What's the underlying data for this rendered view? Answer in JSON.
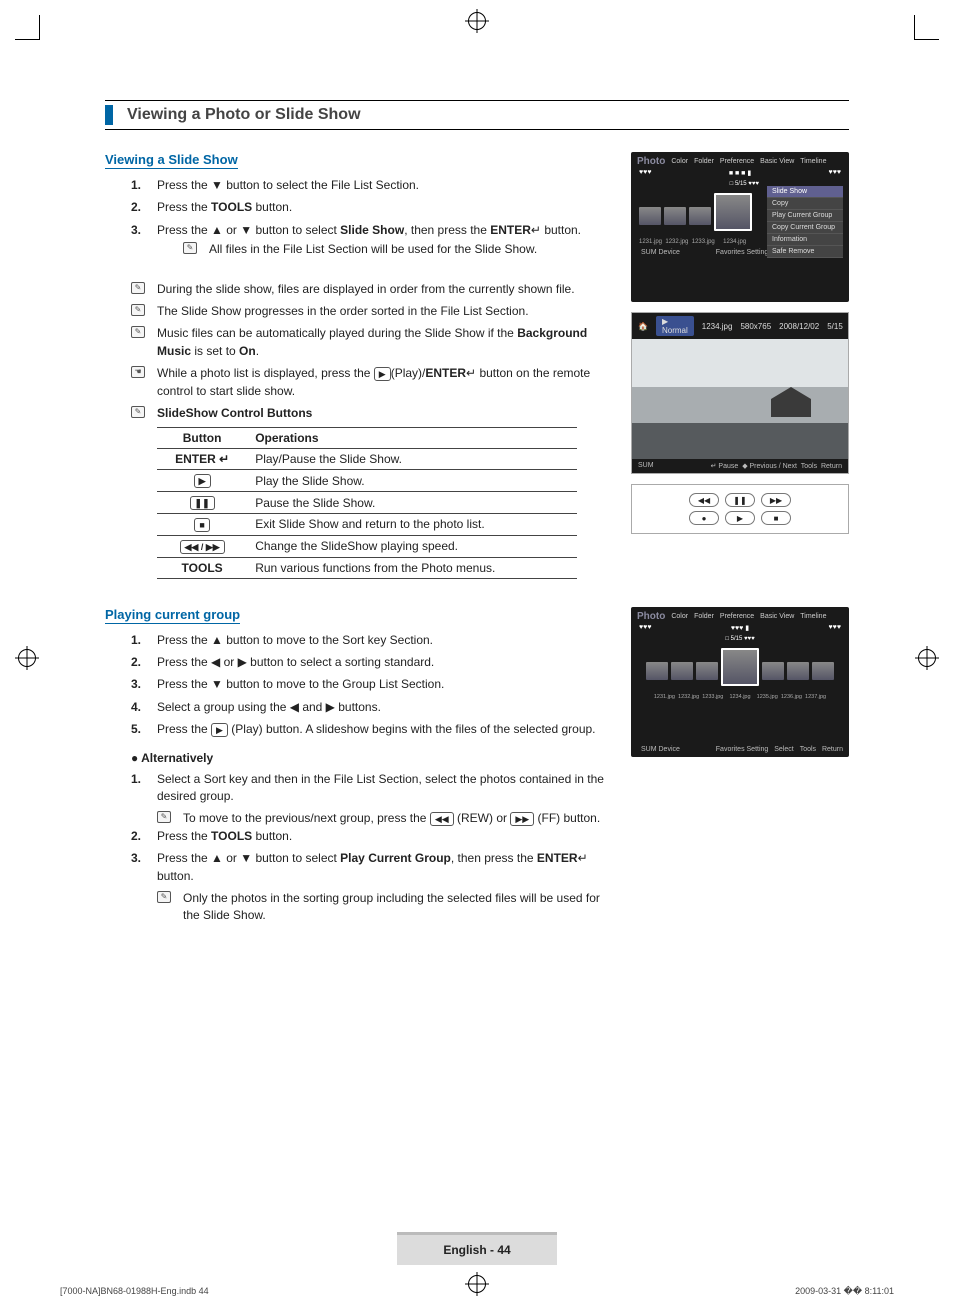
{
  "section_title": "Viewing a Photo or Slide Show",
  "sub1": {
    "heading": "Viewing a Slide Show",
    "steps": [
      {
        "n": "1.",
        "parts": [
          "Press the ▼ button to select the File List Section."
        ]
      },
      {
        "n": "2.",
        "parts": [
          "Press the ",
          {
            "b": "TOOLS"
          },
          " button."
        ]
      },
      {
        "n": "3.",
        "parts": [
          "Press the ▲ or ▼ button to select ",
          {
            "b": "Slide Show"
          },
          ", then press the ",
          {
            "b": "ENTER"
          },
          {
            "icon": "↵"
          },
          " button."
        ]
      }
    ],
    "step3_note": "All files in the File List Section will be used for the Slide Show.",
    "notes": [
      "During the slide show, files are displayed in order from the currently shown file.",
      "The Slide Show progresses in the order sorted in the File List Section.",
      {
        "parts": [
          "Music files can be automatically played during the Slide Show if the ",
          {
            "b": "Background Music"
          },
          " is set to ",
          {
            "b": "On"
          },
          "."
        ]
      },
      {
        "icon": "hand",
        "parts": [
          "While a photo list is displayed, press the ",
          {
            "btn": "▶"
          },
          "(Play)/",
          {
            "b": "ENTER"
          },
          {
            "icon": "↵"
          },
          " button on the remote control to start slide show."
        ]
      },
      {
        "b": "SlideShow Control Buttons"
      }
    ],
    "table": {
      "headers": [
        "Button",
        "Operations"
      ],
      "rows": [
        {
          "btn": "ENTER ↵",
          "op": "Play/Pause the Slide Show."
        },
        {
          "btn": "▶",
          "op": "Play the Slide Show."
        },
        {
          "btn": "❚❚",
          "op": "Pause the Slide Show."
        },
        {
          "btn": "■",
          "op": "Exit Slide Show and return to the photo list."
        },
        {
          "btn": "◀◀ / ▶▶",
          "op": "Change the SlideShow playing speed."
        },
        {
          "btn": "TOOLS",
          "op": "Run various functions from the Photo menus."
        }
      ]
    }
  },
  "sub2": {
    "heading": "Playing current group",
    "steps": [
      {
        "n": "1.",
        "parts": [
          "Press the ▲ button to move to the Sort key Section."
        ]
      },
      {
        "n": "2.",
        "parts": [
          "Press the ◀ or ▶ button to select a sorting standard."
        ]
      },
      {
        "n": "3.",
        "parts": [
          "Press the ▼ button to move to the Group List Section."
        ]
      },
      {
        "n": "4.",
        "parts": [
          "Select a group using the ◀ and ▶ buttons."
        ]
      },
      {
        "n": "5.",
        "parts": [
          "Press the ",
          {
            "btn": "▶"
          },
          " (Play) button. A slideshow begins with the files of the selected group."
        ]
      }
    ],
    "alt_label": "Alternatively",
    "alt_steps": [
      {
        "n": "1.",
        "parts": [
          "Select a Sort key and then in the File List Section, select the photos contained in the desired group."
        ]
      },
      {
        "n": "",
        "note": {
          "parts": [
            "To move to the previous/next group, press the ",
            {
              "btn": "◀◀"
            },
            " (REW) or ",
            {
              "btn": "▶▶"
            },
            " (FF) button."
          ]
        }
      },
      {
        "n": "2.",
        "parts": [
          "Press the ",
          {
            "b": "TOOLS"
          },
          " button."
        ]
      },
      {
        "n": "3.",
        "parts": [
          "Press the ▲ or ▼ button to select ",
          {
            "b": "Play Current Group"
          },
          ", then press the ",
          {
            "b": "ENTER"
          },
          {
            "icon": "↵"
          },
          " button."
        ]
      },
      {
        "n": "",
        "note": "Only the photos in the sorting group including the selected files will be used for the Slide Show."
      }
    ]
  },
  "screenshot1": {
    "title": "Photo",
    "tabs": [
      "Color",
      "Folder",
      "Preference",
      "Basic View",
      "Timeline"
    ],
    "dots_left": "♥♥♥",
    "dots_center": "■ ■ ■ ▮",
    "dots_right": "♥♥♥",
    "marker": "5/15",
    "thumbs": [
      "1231.jpg",
      "1232.jpg",
      "1233.jpg",
      "1234.jpg"
    ],
    "menu": [
      "Slide Show",
      "Copy",
      "Play Current Group",
      "Copy Current Group",
      "Information",
      "Safe Remove"
    ],
    "bottom_left": "SUM    Device",
    "bottom_right": [
      "Favorites Setting",
      "Select",
      "Tools",
      "Return"
    ]
  },
  "preview": {
    "mode": "▶ Normal",
    "file": "1234.jpg",
    "res": "580x765",
    "date": "2008/12/02",
    "idx": "5/15",
    "foot_left": "SUM",
    "foot": [
      "↵ Pause",
      "◆ Previous / Next",
      "Tools",
      "Return"
    ]
  },
  "pad": {
    "row1": [
      "◀◀",
      "❚❚",
      "▶▶"
    ],
    "row2": [
      "●",
      "▶",
      "■"
    ]
  },
  "screenshot2": {
    "title": "Photo",
    "tabs": [
      "Color",
      "Folder",
      "Preference",
      "Basic View",
      "Timeline"
    ],
    "dots_left": "♥♥♥",
    "dots_center": "♥♥♥ ▮",
    "dots_right": "♥♥♥",
    "marker": "5/15",
    "thumbs": [
      "1231.jpg",
      "1232.jpg",
      "1233.jpg",
      "1234.jpg",
      "1235.jpg",
      "1236.jpg",
      "1237.jpg"
    ],
    "bottom_left": "SUM    Device",
    "bottom_right": [
      "Favorites Setting",
      "Select",
      "Tools",
      "Return"
    ]
  },
  "footer": {
    "page": "English - 44"
  },
  "print": {
    "left": "[7000-NA]BN68-01988H-Eng.indb   44",
    "right": "2009-03-31   �� 8:11:01"
  }
}
